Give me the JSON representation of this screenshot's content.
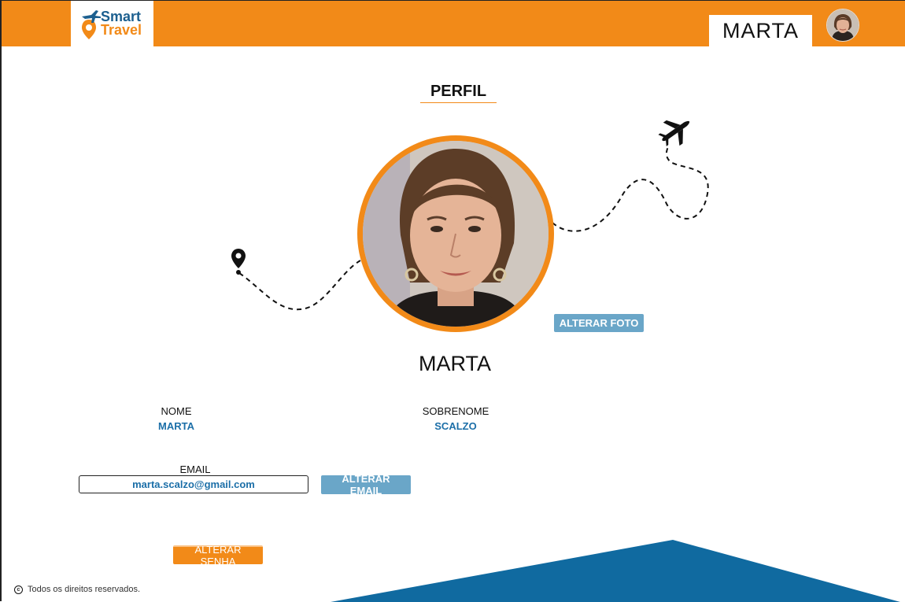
{
  "brand": {
    "logo_line1": "Smart",
    "logo_line2": "Travel"
  },
  "header": {
    "user_name": "MARTA"
  },
  "page": {
    "title": "PERFIL"
  },
  "profile": {
    "display_name": "MARTA",
    "change_photo_label": "ALTERAR FOTO",
    "fields": {
      "nome_label": "NOME",
      "nome_value": "MARTA",
      "sobrenome_label": "SOBRENOME",
      "sobrenome_value": "SCALZO",
      "email_label": "EMAIL",
      "email_value": "marta.scalzo@gmail.com"
    },
    "change_email_label": "ALTERAR EMAIL",
    "change_password_label": "ALTERAR SENHA"
  },
  "footer": {
    "copyright_symbol": "c",
    "text": "Todos os direitos reservados."
  },
  "colors": {
    "brand_orange": "#f28a18",
    "brand_blue": "#1c5f8f",
    "button_blue": "#6aa6c8",
    "wave_blue": "#106aa0"
  }
}
